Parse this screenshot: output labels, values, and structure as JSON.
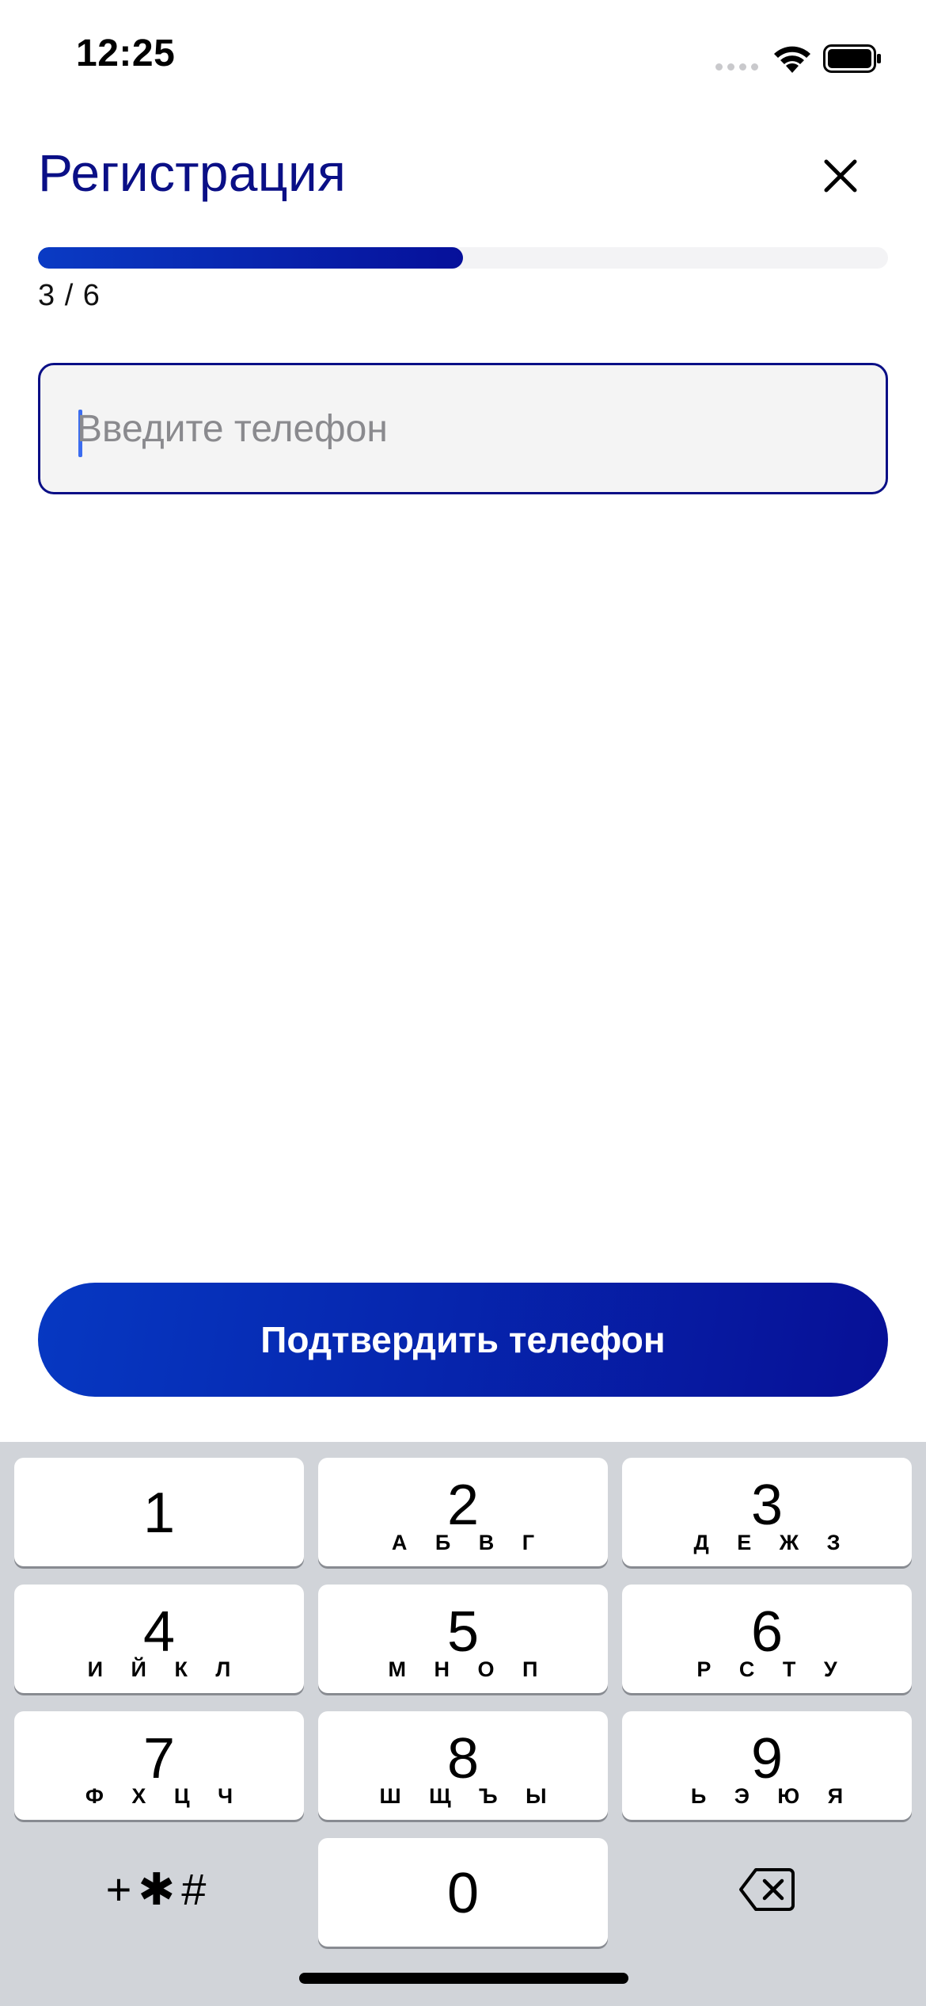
{
  "status_bar": {
    "time": "12:25",
    "signal_icon": "cellular-signal-icon",
    "wifi_icon": "wifi-icon",
    "battery_icon": "battery-full-icon"
  },
  "header": {
    "title": "Регистрация",
    "close_icon": "close-icon"
  },
  "progress": {
    "label": "3 / 6",
    "current_step": 3,
    "total_steps": 6,
    "fraction": 0.5
  },
  "phone_input": {
    "placeholder": "Введите телефон",
    "value": ""
  },
  "confirm_button": {
    "label": "Подтвердить телефон"
  },
  "keyboard": {
    "keys": [
      {
        "digit": "1",
        "letters": ""
      },
      {
        "digit": "2",
        "letters": "А Б В Г"
      },
      {
        "digit": "3",
        "letters": "Д Е Ж З"
      },
      {
        "digit": "4",
        "letters": "И Й К Л"
      },
      {
        "digit": "5",
        "letters": "М Н О П"
      },
      {
        "digit": "6",
        "letters": "Р С Т У"
      },
      {
        "digit": "7",
        "letters": "Ф Х Ц Ч"
      },
      {
        "digit": "8",
        "letters": "Ш Щ Ъ Ы"
      },
      {
        "digit": "9",
        "letters": "Ь Э Ю Я"
      },
      {
        "digit": "0",
        "letters": ""
      }
    ],
    "symbols_label": "+✱#",
    "backspace_icon": "backspace-icon"
  },
  "colors": {
    "brand": "#0a0f86",
    "accent": "#0a3bc4",
    "keyboard_bg": "#d1d4d9"
  }
}
